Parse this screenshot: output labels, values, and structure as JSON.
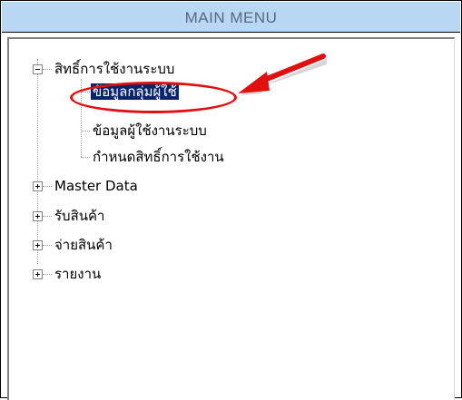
{
  "header": {
    "title": "MAIN MENU"
  },
  "tree": {
    "root_permissions": "สิทธิ์การใช้งานระบบ",
    "children": [
      "ข้อมูลกลุ่มผู้ใช้",
      "ข้อมูลผู้ใช้งานระบบ",
      "กำหนดสิทธิ์การใช้งาน"
    ],
    "others": [
      "Master Data",
      "รับสินค้า",
      "จ่ายสินค้า",
      "รายงาน"
    ]
  },
  "colors": {
    "header_bg": "#b8d7f3",
    "selection_bg": "#0a246a",
    "annotation": "#e01010"
  },
  "icons": [
    "collapse-box-icon",
    "expand-box-icon",
    "red-arrow-annotation",
    "red-ellipse-annotation"
  ]
}
